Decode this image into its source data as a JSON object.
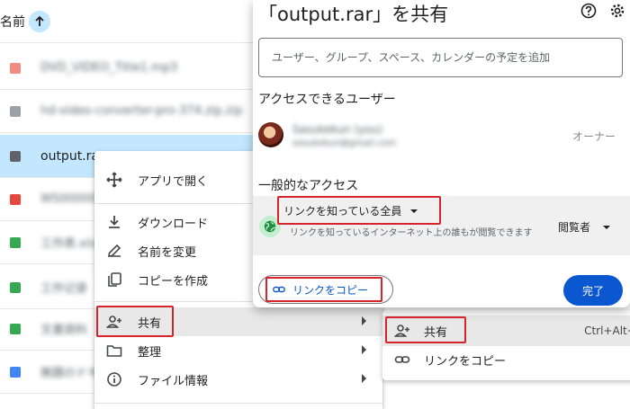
{
  "file_list": {
    "header_label": "名前",
    "rows": [
      {
        "name": "DVD_VIDEO_Title1.mp3",
        "color": "#f28b82",
        "blurred": true
      },
      {
        "name": "hd-video-converter-pro-374.zip.zip",
        "color": "#9aa0a6",
        "blurred": true
      },
      {
        "name": "output.rar",
        "color": "#5f6368",
        "blurred": false
      },
      {
        "name": "WS000001",
        "color": "#e8453c",
        "blurred": true
      },
      {
        "name": "工作表.xlsx",
        "color": "#34a853",
        "blurred": true
      },
      {
        "name": "工作记录",
        "color": "#34a853",
        "blurred": true
      },
      {
        "name": "文書資料",
        "color": "#34a853",
        "blurred": true
      },
      {
        "name": "無題のドキュメント",
        "color": "#4285f4",
        "blurred": true
      }
    ]
  },
  "context_menu": {
    "open_with": "アプリで開く",
    "download": "ダウンロード",
    "rename": "名前を変更",
    "make_copy": "コピーを作成",
    "share": "共有",
    "organize": "整理",
    "file_info": "ファイル情報"
  },
  "submenu": {
    "share": "共有",
    "copy_link": "リンクをコピー",
    "shortcut": "Ctrl+Alt+A"
  },
  "share_dialog": {
    "title": "「output.rar」を共有",
    "add_placeholder": "ユーザー、グループ、スペース、カレンダーの予定を追加",
    "people_title": "アクセスできるユーザー",
    "owner_name": "Sasukekun (you)",
    "owner_email": "sasukekun@gmail.com",
    "owner_role": "オーナー",
    "general_title": "一般的なアクセス",
    "access_option": "リンクを知っている全員",
    "access_desc": "リンクを知っているインターネット上の誰もが閲覧できます",
    "role": "閲覧者",
    "copy_link_label": "リンクをコピー",
    "done_label": "完了"
  },
  "colors": {
    "accent": "#0b57d0",
    "selected_row": "#c2e7ff",
    "highlight": "#d6242c"
  }
}
